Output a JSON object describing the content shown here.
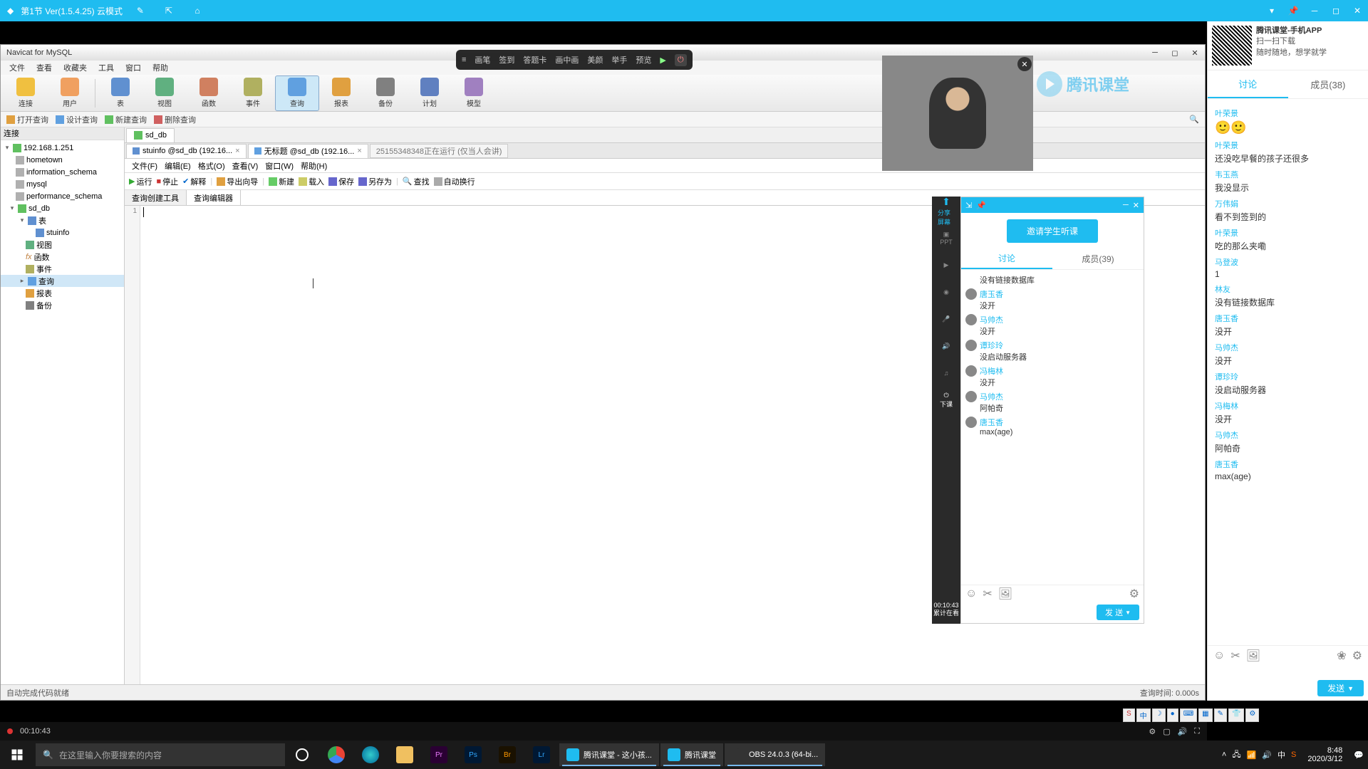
{
  "appBar": {
    "title": "第1节 Ver(1.5.4.25)  云模式"
  },
  "rightPanel": {
    "qr": {
      "title": "腾讯课堂-手机APP",
      "line1": "扫一扫下载",
      "line2": "随时随地，想学就学"
    },
    "tabs": {
      "discuss": "讨论",
      "members": "成员(38)"
    },
    "messages": [
      {
        "user": "叶荣景",
        "text": "🙂🙂",
        "emoji": true
      },
      {
        "user": "叶荣景",
        "text": "还没吃早餐的孩子还很多"
      },
      {
        "user": "韦玉燕",
        "text": "我没显示"
      },
      {
        "user": "万伟娟",
        "text": "看不到签到的"
      },
      {
        "user": "叶荣景",
        "text": "吃的那么夹嘞"
      },
      {
        "user": "马登波",
        "text": "1"
      },
      {
        "user": "林友",
        "text": "没有链接数据库"
      },
      {
        "user": "唐玉香",
        "text": "没开"
      },
      {
        "user": "马帅杰",
        "text": "没开"
      },
      {
        "user": "谭珍玲",
        "text": "没启动服务器"
      },
      {
        "user": "冯梅林",
        "text": "没开"
      },
      {
        "user": "马帅杰",
        "text": "阿帕奇"
      },
      {
        "user": "唐玉香",
        "text": "max(age)"
      }
    ],
    "send": "发送"
  },
  "navicat": {
    "title": "Navicat for MySQL",
    "menu": [
      "文件",
      "查看",
      "收藏夹",
      "工具",
      "窗口",
      "帮助"
    ],
    "toolbar": [
      {
        "label": "连接",
        "color": "#f0c040"
      },
      {
        "label": "用户",
        "color": "#f0a060"
      },
      {
        "label": "表",
        "color": "#6090d0"
      },
      {
        "label": "视图",
        "color": "#60b080"
      },
      {
        "label": "函数",
        "color": "#d08060"
      },
      {
        "label": "事件",
        "color": "#b0b060"
      },
      {
        "label": "查询",
        "color": "#60a0e0",
        "active": true
      },
      {
        "label": "报表",
        "color": "#e0a040"
      },
      {
        "label": "备份",
        "color": "#808080"
      },
      {
        "label": "计划",
        "color": "#6080c0"
      },
      {
        "label": "模型",
        "color": "#a080c0"
      }
    ],
    "subtoolbar": [
      "打开查询",
      "设计查询",
      "新建查询",
      "删除查询"
    ],
    "leftHeader": "连接",
    "tree": {
      "conn": "192.168.1.251",
      "dbs": [
        "hometown",
        "information_schema",
        "mysql",
        "performance_schema"
      ],
      "curDb": "sd_db",
      "nodes": {
        "tables": "表",
        "table1": "stuinfo",
        "views": "视图",
        "funcs": "函数",
        "events": "事件",
        "queries": "查询",
        "reports": "报表",
        "backups": "备份"
      }
    },
    "objTab": "sd_db",
    "docTabs": [
      {
        "label": "stuinfo @sd_db (192.16..."
      },
      {
        "label": "无标题 @sd_db (192.16...",
        "active": true
      }
    ],
    "runTab": "25155348348正在运行 (仅当人会讲)",
    "innerMenu": [
      "文件(F)",
      "编辑(E)",
      "格式(O)",
      "查看(V)",
      "窗口(W)",
      "帮助(H)"
    ],
    "innerTb": {
      "run": "运行",
      "stop": "停止",
      "explain": "解释",
      "export": "导出向导",
      "new": "新建",
      "load": "载入",
      "save": "保存",
      "saveas": "另存为",
      "find": "查找",
      "autowrap": "自动换行"
    },
    "subTabs": [
      "查询创建工具",
      "查询编辑器"
    ],
    "gutterLine": "1",
    "statusLeft": "自动完成代码就绪",
    "statusRight": "查询时间: 0.000s"
  },
  "floatTb": [
    "画笔",
    "签到",
    "答题卡",
    "画中画",
    "美颜",
    "举手",
    "预览"
  ],
  "miniChat": {
    "invite": "邀请学生听课",
    "tabs": {
      "discuss": "讨论",
      "members": "成员(39)"
    },
    "messages": [
      {
        "user": "",
        "text": "没有链接数据库",
        "plain": true
      },
      {
        "user": "唐玉香",
        "text": "没开"
      },
      {
        "user": "马帅杰",
        "text": "没开"
      },
      {
        "user": "谭珍玲",
        "text": "没启动服务器"
      },
      {
        "user": "冯梅林",
        "text": "没开"
      },
      {
        "user": "马帅杰",
        "text": "阿帕奇"
      },
      {
        "user": "唐玉香",
        "text": "max(age)"
      }
    ],
    "send": "发 送"
  },
  "miniSide": {
    "share": "分享屏幕",
    "timer": "00:10:43",
    "stat": "累计在看",
    "xk": "下课"
  },
  "ketang": "腾讯课堂",
  "videoCtrl": {
    "time": "00:10:43"
  },
  "taskbar": {
    "searchPlaceholder": "在这里输入你要搜索的内容",
    "apps": [
      {
        "label": "腾讯课堂 - 这小孩...",
        "color": "#1fbcf0"
      },
      {
        "label": "腾讯课堂",
        "color": "#1fbcf0"
      },
      {
        "label": "OBS 24.0.3 (64-bi...",
        "color": "#333"
      }
    ],
    "clock": {
      "time": "8:48",
      "date": "2020/3/12"
    }
  },
  "ime": [
    "S",
    "中"
  ]
}
